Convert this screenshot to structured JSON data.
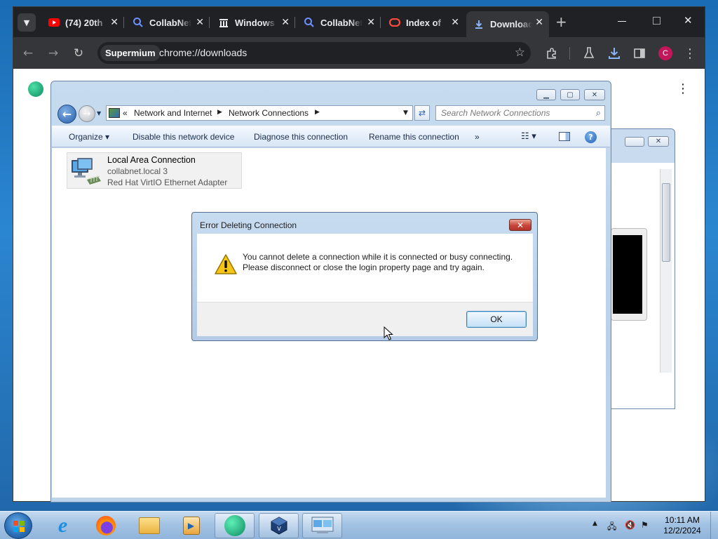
{
  "browser": {
    "tabs": [
      {
        "title": "(74) 20th",
        "favicon": "youtube-icon"
      },
      {
        "title": "CollabNet",
        "favicon": "search-icon"
      },
      {
        "title": "Windows",
        "favicon": "building-icon"
      },
      {
        "title": "CollabNet",
        "favicon": "search-icon"
      },
      {
        "title": "Index of",
        "favicon": "oracle-icon"
      },
      {
        "title": "Downloads",
        "favicon": "download-icon"
      }
    ],
    "omnibox": {
      "chip": "Supermium",
      "url": "chrome://downloads"
    },
    "profile_initial": "C",
    "accent": "#4285f4"
  },
  "explorer": {
    "breadcrumb": {
      "overflow": "«",
      "items": [
        "Network and Internet",
        "Network Connections"
      ]
    },
    "search_placeholder": "Search Network Connections",
    "commands": [
      "Organize",
      "Disable this network device",
      "Diagnose this connection",
      "Rename this connection",
      "»"
    ],
    "connection": {
      "name": "Local Area Connection",
      "network": "collabnet.local  3",
      "adapter": "Red Hat VirtIO Ethernet Adapter"
    }
  },
  "dialog": {
    "title": "Error Deleting Connection",
    "message": "You cannot delete a connection while it is connected or busy connecting. Please disconnect or close the login property page and try again.",
    "ok_label": "OK"
  },
  "taskbar": {
    "time": "10:11 AM",
    "date": "12/2/2024"
  }
}
